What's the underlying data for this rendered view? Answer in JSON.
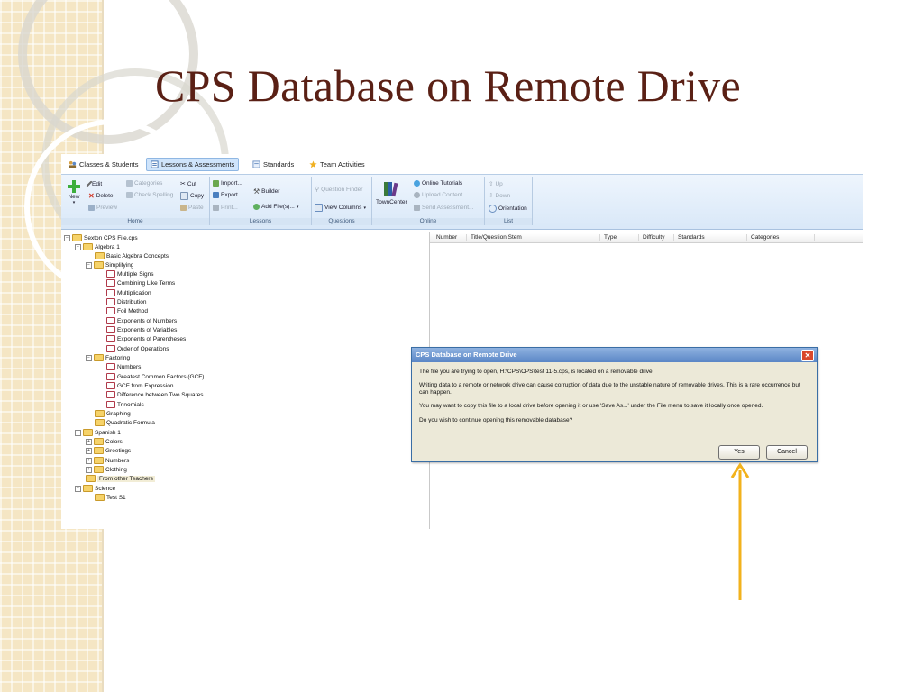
{
  "slide": {
    "title": "CPS Database on Remote Drive"
  },
  "tabs": [
    {
      "label": "Classes & Students",
      "icon": "students-icon"
    },
    {
      "label": "Lessons & Assessments",
      "icon": "lessons-icon",
      "active": true
    },
    {
      "label": "Standards",
      "icon": "standards-icon"
    },
    {
      "label": "Team Activities",
      "icon": "star-icon"
    }
  ],
  "ribbon": {
    "home": {
      "label": "Home",
      "new": "New",
      "edit": "Edit",
      "delete": "Delete",
      "preview": "Preview",
      "categories": "Categories",
      "check_spelling": "Check Spelling",
      "cut": "Cut",
      "copy": "Copy",
      "paste": "Paste"
    },
    "lessons": {
      "label": "Lessons",
      "import": "Import...",
      "export": "Export",
      "print": "Print...",
      "builder": "Builder",
      "add_files": "Add File(s)..."
    },
    "questions": {
      "label": "Questions",
      "question_finder": "Question Finder",
      "view_columns": "View Columns"
    },
    "online": {
      "label": "Online",
      "towncenter": "TownCenter",
      "online_tutorials": "Online Tutorials",
      "upload_content": "Upload Content",
      "send_assessment": "Send Assessment..."
    },
    "list": {
      "label": "List",
      "up": "Up",
      "down": "Down",
      "orientation": "Orientation"
    }
  },
  "tree": {
    "root": "Sexton CPS File.cps",
    "algebra": "Algebra 1",
    "basic": "Basic Algebra Concepts",
    "simplifying": "Simplifying",
    "simplifying_items": [
      "Multiple Signs",
      "Combining Like Terms",
      "Multiplication",
      "Distribution",
      "Foil Method",
      "Exponents of Numbers",
      "Exponents of Variables",
      "Exponents of Parentheses",
      "Order of Operations"
    ],
    "factoring": "Factoring",
    "factoring_items": [
      "Numbers",
      "Greatest Common Factors (GCF)",
      "GCF from Expression",
      "Difference between Two Squares",
      "Trinomials"
    ],
    "graphing": "Graphing",
    "quadratic": "Quadratic Formula",
    "spanish": "Spanish 1",
    "spanish_items": [
      "Colors",
      "Greetings",
      "Numbers",
      "Clothing"
    ],
    "other_teachers": "From other Teachers",
    "science": "Science",
    "test": "Test S1"
  },
  "grid": {
    "columns": [
      "Number",
      "Title/Question Stem",
      "Type",
      "Difficulty",
      "Standards",
      "Categories"
    ]
  },
  "dialog": {
    "title": "CPS Database on Remote Drive",
    "line1": "The file you are trying to open, H:\\CPS\\CPS\\test  11-5.cps, is located on a removable drive.",
    "line2": "Writing data to a remote or network drive can cause corruption of data due to the unstable nature of removable drives. This is a rare occurrence but can happen.",
    "line3": "You may want to copy this file to a local drive before opening it or use 'Save As...' under the File menu to save it locally once opened.",
    "line4": "Do you wish to continue opening this removable database?",
    "yes": "Yes",
    "cancel": "Cancel"
  },
  "colors": {
    "title": "#5a2015",
    "arrow": "#f2b21c",
    "ribbon": "#d9e8f8",
    "dialog_bar": "#5a86c6"
  }
}
